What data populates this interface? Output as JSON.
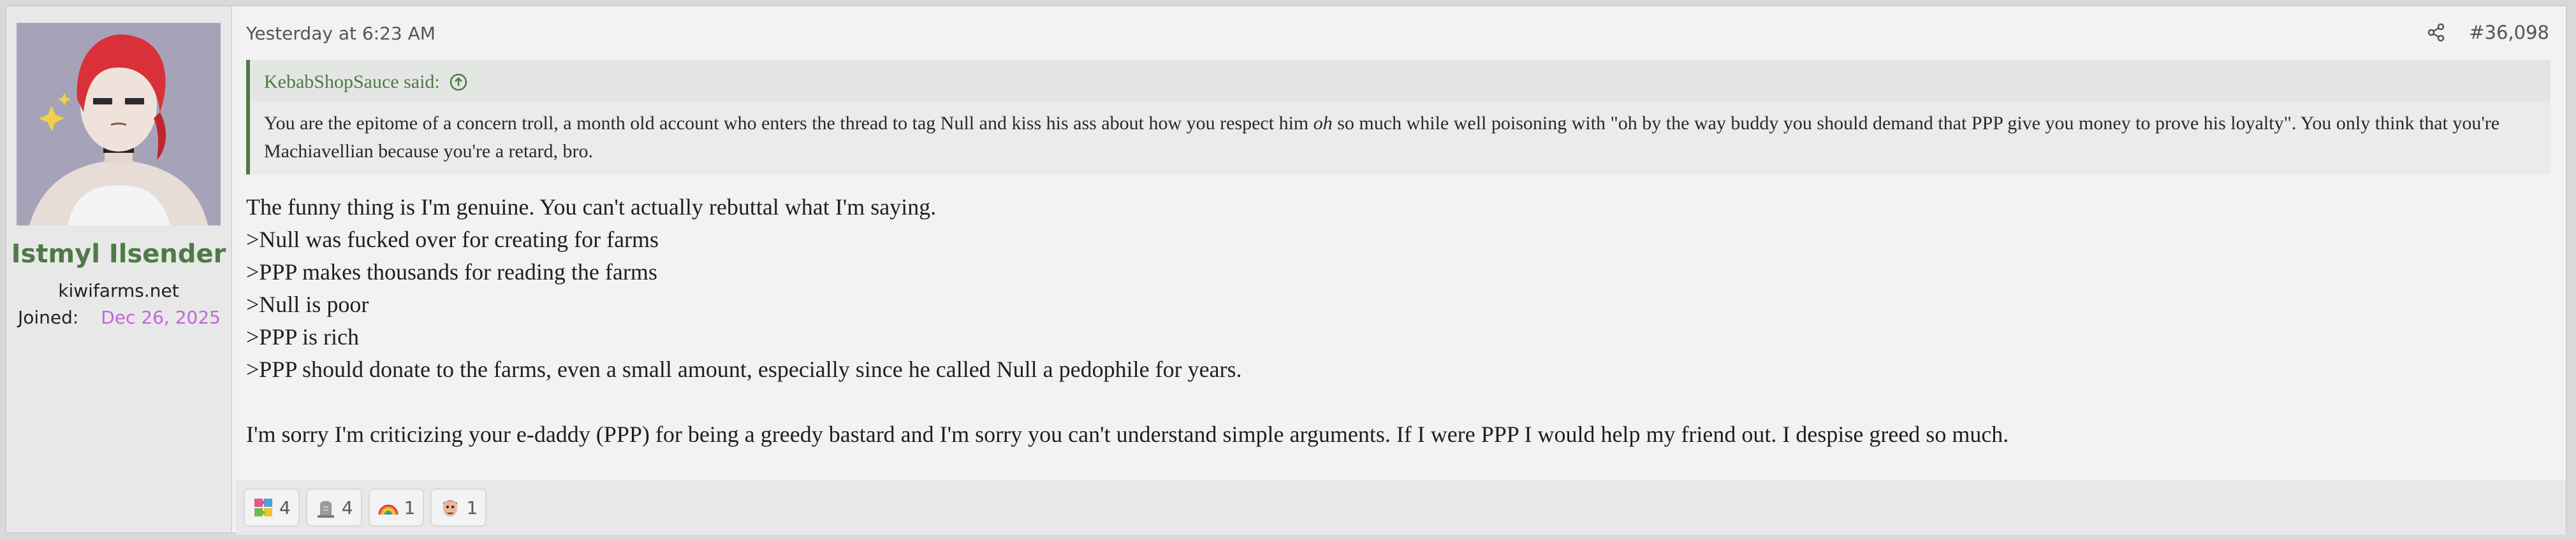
{
  "author": {
    "username": "Istmyl Ilsender",
    "domain": "kiwifarms.net",
    "joined_label": "Joined:",
    "joined_value": "Dec 26, 2025"
  },
  "post": {
    "timestamp": "Yesterday at 6:23 AM",
    "number": "#36,098"
  },
  "quote": {
    "attribution": "KebabShopSauce said:",
    "text_before": "You are the epitome of a concern troll, a month old account who enters the thread to tag Null and kiss his ass about how you respect him ",
    "text_em": "oh",
    "text_after": " so much while well poisoning with \"oh by the way buddy you should demand that PPP give you money to prove his loyalty\". You only think that you're Machiavellian because you're a retard, bro."
  },
  "body": [
    "The funny thing is I'm genuine. You can't actually rebuttal what I'm saying.",
    ">Null was fucked over for creating for farms",
    ">PPP makes thousands for reading the farms",
    ">Null is poor",
    ">PPP is rich",
    ">PPP should donate to the farms, even a small amount, especially since he called Null a pedophile for years.",
    "I'm sorry I'm criticizing your e-daddy (PPP) for being a greedy bastard and I'm sorry you can't understand simple arguments. If I were PPP I would help my friend out. I despise greed so much."
  ],
  "reactions": [
    {
      "icon": "puzzle-icon",
      "count": "4"
    },
    {
      "icon": "gravestone-icon",
      "count": "4"
    },
    {
      "icon": "rainbow-icon",
      "count": "1"
    },
    {
      "icon": "face-icon",
      "count": "1"
    }
  ],
  "colors": {
    "username": "#4e7a46",
    "joined_date": "#c068d6",
    "quote_border": "#4e7a46"
  }
}
